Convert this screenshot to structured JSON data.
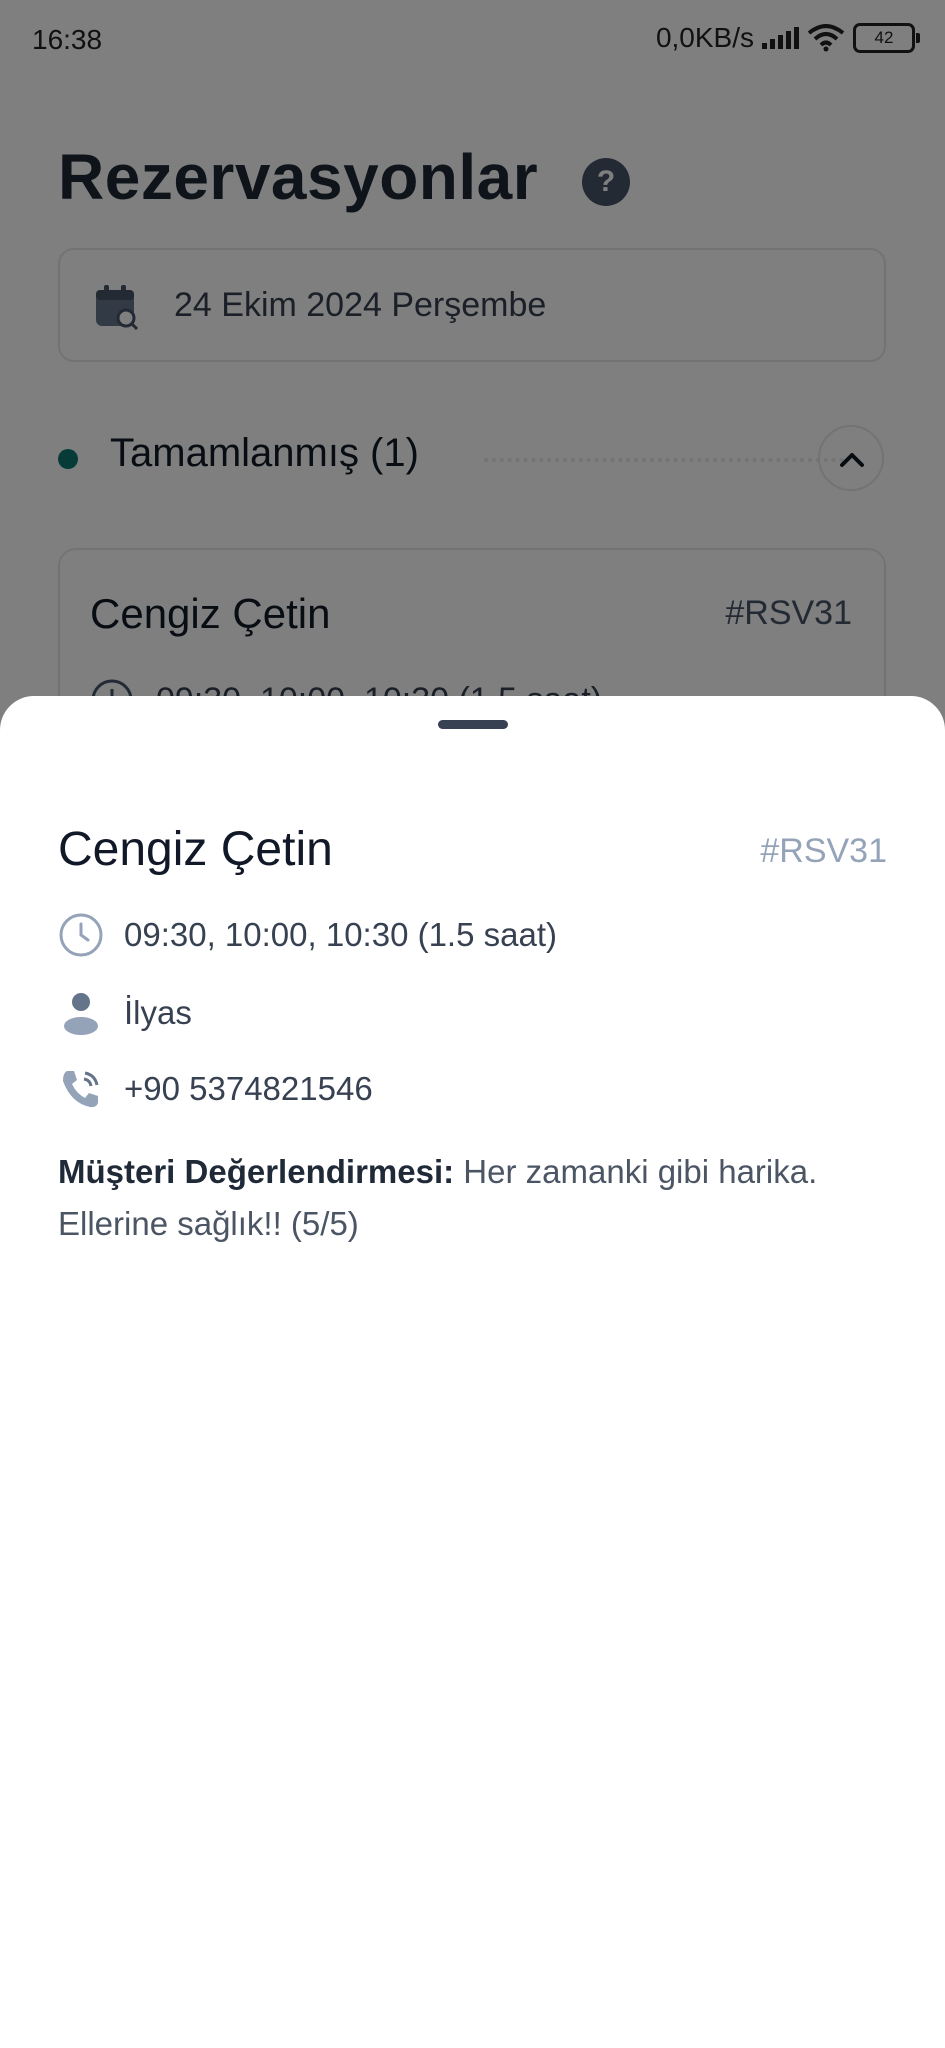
{
  "status_bar": {
    "time": "16:38",
    "network_speed": "0,0KB/s",
    "battery": "42",
    "icons": [
      "signal-icon",
      "wifi-icon",
      "battery-icon"
    ]
  },
  "page": {
    "title": "Rezervasyonlar",
    "help_icon": "?",
    "date": "24 Ekim 2024 Perşembe",
    "section": {
      "title": "Tamamlanmış (1)",
      "status_color": "#0f766e"
    },
    "card": {
      "name": "Cengiz Çetin",
      "id": "#RSV31",
      "times": "09:30, 10:00, 10:30 (1.5 saat)"
    }
  },
  "sheet": {
    "name": "Cengiz Çetin",
    "id": "#RSV31",
    "times": "09:30, 10:00, 10:30 (1.5 saat)",
    "staff": "İlyas",
    "phone": "+90 5374821546",
    "rating_label": "Müşteri Değerlendirmesi:",
    "rating_text": "Her zamanki gibi harika. Ellerine sağlık!!  (5/5)"
  }
}
